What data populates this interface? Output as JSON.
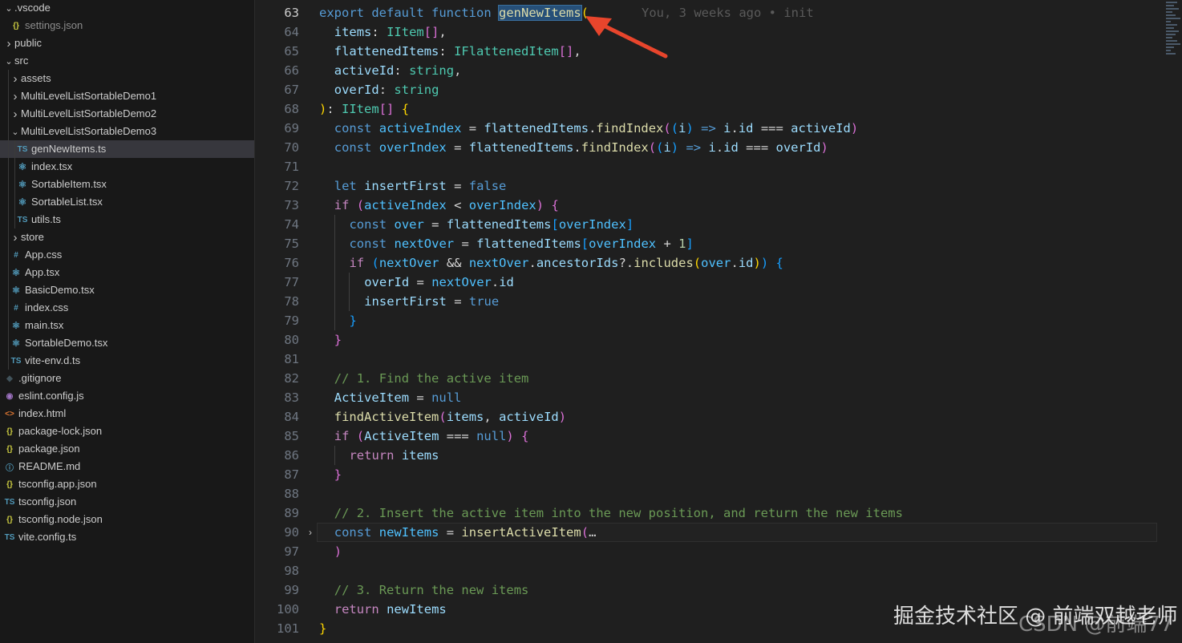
{
  "explorer": {
    "items": [
      {
        "label": ".vscode",
        "type": "folder",
        "open": true,
        "depth": 0,
        "icon": "chevron-down-icon"
      },
      {
        "label": "settings.json",
        "type": "json",
        "depth": 1,
        "icon": "json-icon",
        "muted": true
      },
      {
        "label": "public",
        "type": "folder",
        "open": false,
        "depth": 0,
        "icon": "chevron-right-icon"
      },
      {
        "label": "src",
        "type": "folder",
        "open": true,
        "depth": 0,
        "icon": "chevron-down-icon"
      },
      {
        "label": "assets",
        "type": "folder",
        "open": false,
        "depth": 1,
        "icon": "chevron-right-icon"
      },
      {
        "label": "MultiLevelListSortableDemo1",
        "type": "folder",
        "open": false,
        "depth": 1,
        "icon": "chevron-right-icon"
      },
      {
        "label": "MultiLevelListSortableDemo2",
        "type": "folder",
        "open": false,
        "depth": 1,
        "icon": "chevron-right-icon"
      },
      {
        "label": "MultiLevelListSortableDemo3",
        "type": "folder",
        "open": true,
        "depth": 1,
        "icon": "chevron-down-icon"
      },
      {
        "label": "genNewItems.ts",
        "type": "ts",
        "depth": 2,
        "icon": "typescript-icon",
        "selected": true
      },
      {
        "label": "index.tsx",
        "type": "tsx",
        "depth": 2,
        "icon": "react-icon"
      },
      {
        "label": "SortableItem.tsx",
        "type": "tsx",
        "depth": 2,
        "icon": "react-icon"
      },
      {
        "label": "SortableList.tsx",
        "type": "tsx",
        "depth": 2,
        "icon": "react-icon"
      },
      {
        "label": "utils.ts",
        "type": "ts",
        "depth": 2,
        "icon": "typescript-icon"
      },
      {
        "label": "store",
        "type": "folder",
        "open": false,
        "depth": 1,
        "icon": "chevron-right-icon"
      },
      {
        "label": "App.css",
        "type": "css",
        "depth": 1,
        "icon": "css-icon"
      },
      {
        "label": "App.tsx",
        "type": "tsx",
        "depth": 1,
        "icon": "react-icon"
      },
      {
        "label": "BasicDemo.tsx",
        "type": "tsx",
        "depth": 1,
        "icon": "react-icon"
      },
      {
        "label": "index.css",
        "type": "css",
        "depth": 1,
        "icon": "css-icon"
      },
      {
        "label": "main.tsx",
        "type": "tsx",
        "depth": 1,
        "icon": "react-icon"
      },
      {
        "label": "SortableDemo.tsx",
        "type": "tsx",
        "depth": 1,
        "icon": "react-icon"
      },
      {
        "label": "vite-env.d.ts",
        "type": "ts",
        "depth": 1,
        "icon": "typescript-icon"
      },
      {
        "label": ".gitignore",
        "type": "git",
        "depth": 0,
        "icon": "git-icon"
      },
      {
        "label": "eslint.config.js",
        "type": "eslint",
        "depth": 0,
        "icon": "eslint-icon"
      },
      {
        "label": "index.html",
        "type": "html",
        "depth": 0,
        "icon": "html-icon"
      },
      {
        "label": "package-lock.json",
        "type": "json",
        "depth": 0,
        "icon": "json-icon"
      },
      {
        "label": "package.json",
        "type": "json",
        "depth": 0,
        "icon": "json-icon"
      },
      {
        "label": "README.md",
        "type": "md",
        "depth": 0,
        "icon": "info-icon"
      },
      {
        "label": "tsconfig.app.json",
        "type": "json",
        "depth": 0,
        "icon": "json-icon"
      },
      {
        "label": "tsconfig.json",
        "type": "tsconfig",
        "depth": 0,
        "icon": "tsconfig-icon"
      },
      {
        "label": "tsconfig.node.json",
        "type": "json",
        "depth": 0,
        "icon": "json-icon"
      },
      {
        "label": "vite.config.ts",
        "type": "ts",
        "depth": 0,
        "icon": "typescript-icon"
      }
    ],
    "icon_glyphs": {
      "json": "{}",
      "ts": "TS",
      "tsx": "⚛",
      "css": "#",
      "git": "◆",
      "eslint": "◉",
      "html": "<>",
      "md": "ⓘ",
      "tsconfig": "TS"
    },
    "icon_colors": {
      "json": "#cbcb41",
      "ts": "#519aba",
      "tsx": "#519aba",
      "css": "#519aba",
      "git": "#41535b",
      "eslint": "#a074c4",
      "html": "#e37933",
      "md": "#519aba",
      "tsconfig": "#519aba"
    }
  },
  "editor": {
    "active_line": 63,
    "blame": "You, 3 weeks ago • init",
    "lines": [
      {
        "n": 63,
        "indent": 0,
        "tokens": [
          [
            "kw",
            "export"
          ],
          [
            "pun",
            " "
          ],
          [
            "kw",
            "default"
          ],
          [
            "pun",
            " "
          ],
          [
            "kw",
            "function"
          ],
          [
            "pun",
            " "
          ],
          [
            "fnsel",
            "genNewItems"
          ],
          [
            "b1",
            "("
          ]
        ]
      },
      {
        "n": 64,
        "indent": 1,
        "tokens": [
          [
            "var",
            "items"
          ],
          [
            "pun",
            ": "
          ],
          [
            "ty",
            "IItem"
          ],
          [
            "b2",
            "[]"
          ],
          [
            "pun",
            ","
          ]
        ]
      },
      {
        "n": 65,
        "indent": 1,
        "tokens": [
          [
            "var",
            "flattenedItems"
          ],
          [
            "pun",
            ": "
          ],
          [
            "ty",
            "IFlattenedItem"
          ],
          [
            "b2",
            "[]"
          ],
          [
            "pun",
            ","
          ]
        ]
      },
      {
        "n": 66,
        "indent": 1,
        "tokens": [
          [
            "var",
            "activeId"
          ],
          [
            "pun",
            ": "
          ],
          [
            "ty",
            "string"
          ],
          [
            "pun",
            ","
          ]
        ]
      },
      {
        "n": 67,
        "indent": 1,
        "tokens": [
          [
            "var",
            "overId"
          ],
          [
            "pun",
            ": "
          ],
          [
            "ty",
            "string"
          ]
        ]
      },
      {
        "n": 68,
        "indent": 0,
        "tokens": [
          [
            "b1",
            ")"
          ],
          [
            "pun",
            ": "
          ],
          [
            "ty",
            "IItem"
          ],
          [
            "b2",
            "[]"
          ],
          [
            "pun",
            " "
          ],
          [
            "b1",
            "{"
          ]
        ]
      },
      {
        "n": 69,
        "indent": 1,
        "tokens": [
          [
            "kw",
            "const"
          ],
          [
            "pun",
            " "
          ],
          [
            "cst",
            "activeIndex"
          ],
          [
            "pun",
            " = "
          ],
          [
            "var",
            "flattenedItems"
          ],
          [
            "pun",
            "."
          ],
          [
            "fn",
            "findIndex"
          ],
          [
            "b2",
            "("
          ],
          [
            "b3",
            "("
          ],
          [
            "var",
            "i"
          ],
          [
            "b3",
            ")"
          ],
          [
            "pun",
            " "
          ],
          [
            "kw",
            "=>"
          ],
          [
            "pun",
            " "
          ],
          [
            "var",
            "i"
          ],
          [
            "pun",
            "."
          ],
          [
            "var",
            "id"
          ],
          [
            "pun",
            " === "
          ],
          [
            "var",
            "activeId"
          ],
          [
            "b2",
            ")"
          ]
        ]
      },
      {
        "n": 70,
        "indent": 1,
        "tokens": [
          [
            "kw",
            "const"
          ],
          [
            "pun",
            " "
          ],
          [
            "cst",
            "overIndex"
          ],
          [
            "pun",
            " = "
          ],
          [
            "var",
            "flattenedItems"
          ],
          [
            "pun",
            "."
          ],
          [
            "fn",
            "findIndex"
          ],
          [
            "b2",
            "("
          ],
          [
            "b3",
            "("
          ],
          [
            "var",
            "i"
          ],
          [
            "b3",
            ")"
          ],
          [
            "pun",
            " "
          ],
          [
            "kw",
            "=>"
          ],
          [
            "pun",
            " "
          ],
          [
            "var",
            "i"
          ],
          [
            "pun",
            "."
          ],
          [
            "var",
            "id"
          ],
          [
            "pun",
            " === "
          ],
          [
            "var",
            "overId"
          ],
          [
            "b2",
            ")"
          ]
        ]
      },
      {
        "n": 71,
        "indent": 0,
        "tokens": []
      },
      {
        "n": 72,
        "indent": 1,
        "tokens": [
          [
            "kw",
            "let"
          ],
          [
            "pun",
            " "
          ],
          [
            "var",
            "insertFirst"
          ],
          [
            "pun",
            " = "
          ],
          [
            "kw",
            "false"
          ]
        ]
      },
      {
        "n": 73,
        "indent": 1,
        "tokens": [
          [
            "ctl",
            "if"
          ],
          [
            "pun",
            " "
          ],
          [
            "b2",
            "("
          ],
          [
            "cst",
            "activeIndex"
          ],
          [
            "pun",
            " < "
          ],
          [
            "cst",
            "overIndex"
          ],
          [
            "b2",
            ")"
          ],
          [
            "pun",
            " "
          ],
          [
            "b2",
            "{"
          ]
        ]
      },
      {
        "n": 74,
        "indent": 2,
        "tokens": [
          [
            "kw",
            "const"
          ],
          [
            "pun",
            " "
          ],
          [
            "cst",
            "over"
          ],
          [
            "pun",
            " = "
          ],
          [
            "var",
            "flattenedItems"
          ],
          [
            "b3",
            "["
          ],
          [
            "cst",
            "overIndex"
          ],
          [
            "b3",
            "]"
          ]
        ]
      },
      {
        "n": 75,
        "indent": 2,
        "tokens": [
          [
            "kw",
            "const"
          ],
          [
            "pun",
            " "
          ],
          [
            "cst",
            "nextOver"
          ],
          [
            "pun",
            " = "
          ],
          [
            "var",
            "flattenedItems"
          ],
          [
            "b3",
            "["
          ],
          [
            "cst",
            "overIndex"
          ],
          [
            "pun",
            " + "
          ],
          [
            "num",
            "1"
          ],
          [
            "b3",
            "]"
          ]
        ]
      },
      {
        "n": 76,
        "indent": 2,
        "tokens": [
          [
            "ctl",
            "if"
          ],
          [
            "pun",
            " "
          ],
          [
            "b3",
            "("
          ],
          [
            "cst",
            "nextOver"
          ],
          [
            "pun",
            " && "
          ],
          [
            "cst",
            "nextOver"
          ],
          [
            "pun",
            "."
          ],
          [
            "var",
            "ancestorIds"
          ],
          [
            "pun",
            "?."
          ],
          [
            "fn",
            "includes"
          ],
          [
            "b1",
            "("
          ],
          [
            "cst",
            "over"
          ],
          [
            "pun",
            "."
          ],
          [
            "var",
            "id"
          ],
          [
            "b1",
            ")"
          ],
          [
            "b3",
            ")"
          ],
          [
            "pun",
            " "
          ],
          [
            "b3",
            "{"
          ]
        ]
      },
      {
        "n": 77,
        "indent": 3,
        "tokens": [
          [
            "var",
            "overId"
          ],
          [
            "pun",
            " = "
          ],
          [
            "cst",
            "nextOver"
          ],
          [
            "pun",
            "."
          ],
          [
            "var",
            "id"
          ]
        ]
      },
      {
        "n": 78,
        "indent": 3,
        "tokens": [
          [
            "var",
            "insertFirst"
          ],
          [
            "pun",
            " = "
          ],
          [
            "kw",
            "true"
          ]
        ]
      },
      {
        "n": 79,
        "indent": 2,
        "tokens": [
          [
            "b3",
            "}"
          ]
        ]
      },
      {
        "n": 80,
        "indent": 1,
        "tokens": [
          [
            "b2",
            "}"
          ]
        ]
      },
      {
        "n": 81,
        "indent": 0,
        "tokens": []
      },
      {
        "n": 82,
        "indent": 1,
        "tokens": [
          [
            "com",
            "// 1. Find the active item"
          ]
        ]
      },
      {
        "n": 83,
        "indent": 1,
        "tokens": [
          [
            "var",
            "ActiveItem"
          ],
          [
            "pun",
            " = "
          ],
          [
            "kw",
            "null"
          ]
        ]
      },
      {
        "n": 84,
        "indent": 1,
        "tokens": [
          [
            "fn",
            "findActiveItem"
          ],
          [
            "b2",
            "("
          ],
          [
            "var",
            "items"
          ],
          [
            "pun",
            ", "
          ],
          [
            "var",
            "activeId"
          ],
          [
            "b2",
            ")"
          ]
        ]
      },
      {
        "n": 85,
        "indent": 1,
        "tokens": [
          [
            "ctl",
            "if"
          ],
          [
            "pun",
            " "
          ],
          [
            "b2",
            "("
          ],
          [
            "var",
            "ActiveItem"
          ],
          [
            "pun",
            " === "
          ],
          [
            "kw",
            "null"
          ],
          [
            "b2",
            ")"
          ],
          [
            "pun",
            " "
          ],
          [
            "b2",
            "{"
          ]
        ]
      },
      {
        "n": 86,
        "indent": 2,
        "tokens": [
          [
            "ctl",
            "return"
          ],
          [
            "pun",
            " "
          ],
          [
            "var",
            "items"
          ]
        ]
      },
      {
        "n": 87,
        "indent": 1,
        "tokens": [
          [
            "b2",
            "}"
          ]
        ]
      },
      {
        "n": 88,
        "indent": 0,
        "tokens": []
      },
      {
        "n": 89,
        "indent": 1,
        "tokens": [
          [
            "com",
            "// 2. Insert the active item into the new position, and return the new items"
          ]
        ]
      },
      {
        "n": 90,
        "indent": 1,
        "folded": true,
        "highlight": true,
        "tokens": [
          [
            "kw",
            "const"
          ],
          [
            "pun",
            " "
          ],
          [
            "cst",
            "newItems"
          ],
          [
            "pun",
            " = "
          ],
          [
            "fn",
            "insertActiveItem"
          ],
          [
            "b2",
            "("
          ],
          [
            "pun",
            "…"
          ]
        ]
      },
      {
        "n": 97,
        "indent": 1,
        "tokens": [
          [
            "b2",
            ")"
          ]
        ]
      },
      {
        "n": 98,
        "indent": 0,
        "tokens": []
      },
      {
        "n": 99,
        "indent": 1,
        "tokens": [
          [
            "com",
            "// 3. Return the new items"
          ]
        ]
      },
      {
        "n": 100,
        "indent": 1,
        "tokens": [
          [
            "ctl",
            "return"
          ],
          [
            "pun",
            " "
          ],
          [
            "var",
            "newItems"
          ]
        ]
      },
      {
        "n": 101,
        "indent": 0,
        "tokens": [
          [
            "b1",
            "}"
          ]
        ]
      }
    ]
  },
  "watermark": {
    "text": "掘金技术社区 @ 前端双越老师",
    "text2": "CSDN @前端77"
  },
  "annotation": {
    "arrow_color": "#e8452c"
  }
}
